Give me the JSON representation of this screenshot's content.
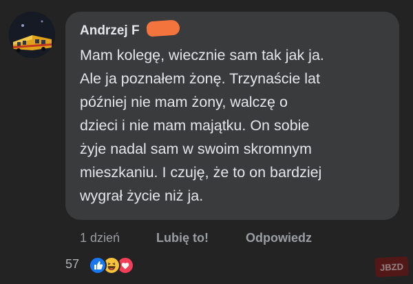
{
  "comment": {
    "author": "Andrzej F",
    "lines": [
      "Mam kolegę, wiecznie sam tak jak ja.",
      "Ale ja poznałem żonę. Trzynaście lat",
      "później nie mam żony, walczę o",
      "dzieci i nie mam majątku. On sobie",
      "żyje nadal sam w swoim skromnym",
      "mieszkaniu. I czuję, że to on bardziej",
      "wygrał życie niż ja."
    ]
  },
  "actions": {
    "time": "1 dzień",
    "like": "Lubię to!",
    "reply": "Odpowiedz"
  },
  "reactions": {
    "count": "57",
    "icons": [
      "like-icon",
      "haha-icon",
      "love-icon"
    ]
  },
  "watermark": "JBZD",
  "colors": {
    "background": "#232323",
    "bubble": "#3a3b3c",
    "text": "#e4e6eb",
    "muted": "#9a9da2",
    "redaction": "#f4743d",
    "like": "#1877f2",
    "haha": "#f7c33b",
    "love": "#f33e58"
  }
}
